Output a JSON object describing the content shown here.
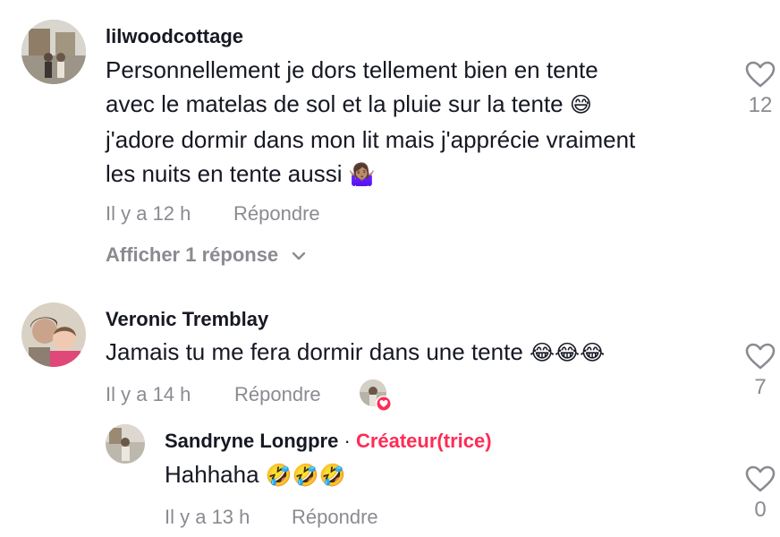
{
  "comments": [
    {
      "username": "lilwoodcottage",
      "lines": [
        "Personnellement je dors tellement bien en tente",
        "avec le matelas de sol et la pluie sur la tente",
        "j'adore dormir dans mon lit mais j'apprécie vraiment",
        "les nuits en tente aussi"
      ],
      "emoji_line2": "😅",
      "emoji_line4": "🤷🏽‍♀️",
      "time": "Il y a 12 h",
      "reply_label": "Répondre",
      "likes": "12",
      "view_replies": "Afficher 1 réponse"
    },
    {
      "username": "Veronic Tremblay",
      "text": "Jamais tu me fera dormir dans une tente",
      "emoji": "😂😂😂",
      "time": "Il y a 14 h",
      "reply_label": "Répondre",
      "likes": "7"
    }
  ],
  "reply": {
    "username": "Sandryne Longpre",
    "separator": "·",
    "badge": "Créateur(trice)",
    "text": "Hahhaha",
    "emoji": "🤣🤣🤣",
    "time": "Il y a 13 h",
    "reply_label": "Répondre",
    "likes": "0"
  },
  "colors": {
    "text": "#161823",
    "muted": "#8a8b91",
    "creator": "#fe2c55"
  }
}
